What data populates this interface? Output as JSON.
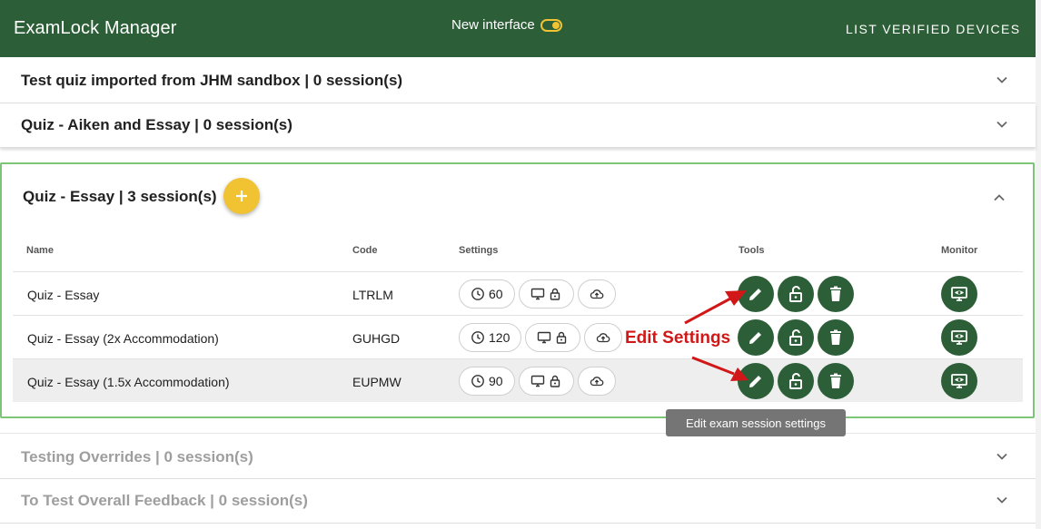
{
  "app": {
    "title": "ExamLock Manager",
    "new_interface_label": "New interface",
    "list_verified_label": "LIST VERIFIED DEVICES",
    "accent": "#2c5e37",
    "yellow": "#f1c232"
  },
  "quizzes_top": [
    {
      "title": "Test quiz imported from JHM sandbox | 0 session(s)"
    },
    {
      "title": "Quiz - Aiken and Essay | 0 session(s)"
    }
  ],
  "expanded": {
    "title": "Quiz - Essay | 3 session(s)",
    "headers": {
      "name": "Name",
      "code": "Code",
      "settings": "Settings",
      "tools": "Tools",
      "monitor": "Monitor"
    },
    "rows": [
      {
        "name": "Quiz - Essay",
        "code": "LTRLM",
        "time": "60"
      },
      {
        "name": "Quiz - Essay (2x Accommodation)",
        "code": "GUHGD",
        "time": "120"
      },
      {
        "name": "Quiz - Essay (1.5x Accommodation)",
        "code": "EUPMW",
        "time": "90"
      }
    ]
  },
  "quizzes_bottom": [
    {
      "title": "Testing Overrides | 0 session(s)"
    },
    {
      "title": "To Test Overall Feedback | 0 session(s)"
    }
  ],
  "annotation": {
    "label": "Edit Settings",
    "color": "#d11717"
  },
  "tooltip": {
    "text": "Edit exam session settings"
  }
}
